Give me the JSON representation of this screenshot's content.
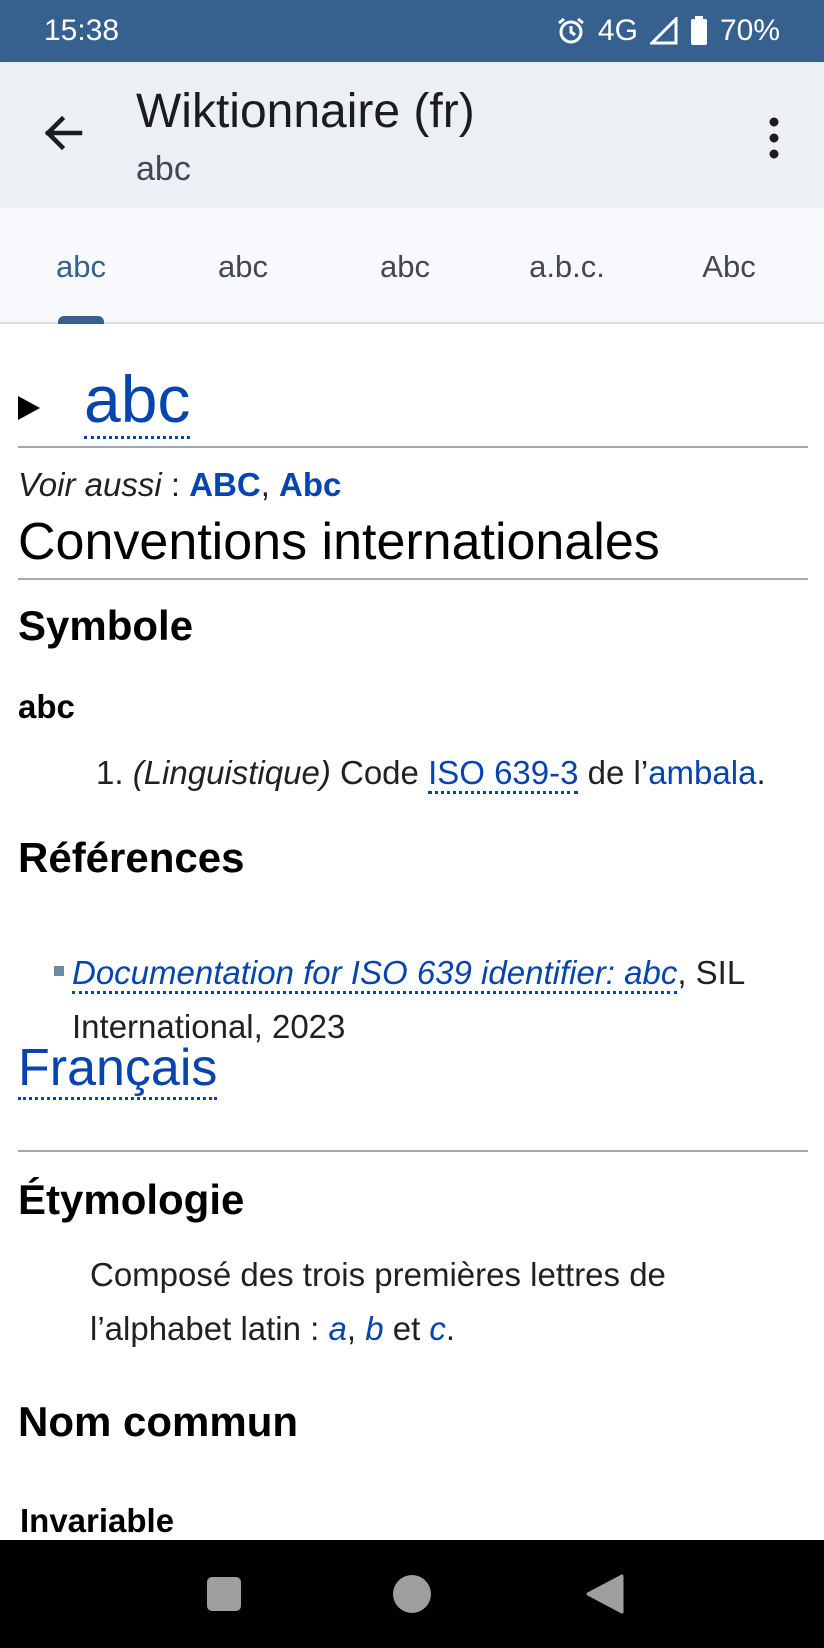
{
  "status_bar": {
    "time": "15:38",
    "network": "4G",
    "battery": "70%",
    "alarm_icon": "alarm-icon",
    "signal_icon": "signal-icon",
    "battery_icon": "battery-icon"
  },
  "app_bar": {
    "back_icon": "arrow-back-icon",
    "title": "Wiktionnaire (fr)",
    "subtitle": "abc",
    "more_icon": "more-vert-icon"
  },
  "tabs": [
    {
      "label": "abc",
      "active": true
    },
    {
      "label": "abc",
      "active": false
    },
    {
      "label": "abc",
      "active": false
    },
    {
      "label": "a.b.c.",
      "active": false
    },
    {
      "label": "Abc",
      "active": false
    }
  ],
  "article": {
    "heading": "abc",
    "voir_aussi": {
      "label": "Voir aussi",
      "sep": " : ",
      "links": [
        "ABC",
        "Abc"
      ],
      "comma": ", "
    },
    "section_conventions": "Conventions internationales",
    "symbole_heading": "Symbole",
    "symbole_word": "abc",
    "definition": {
      "number": "1.",
      "domain": "(Linguistique)",
      "text_code": " Code ",
      "link_iso": "ISO 639-3",
      "text_de": " de l’",
      "link_lang": "ambala",
      "end": "."
    },
    "references_heading": "Références",
    "reference": {
      "link": "Documentation for ISO 639 identifier: abc",
      "rest_line1": ", SIL",
      "rest_line2": "International, 2023"
    },
    "francais_heading": "Français",
    "etymologie_heading": "Étymologie",
    "etymologie": {
      "line1": "Composé des trois premières lettres de",
      "line2_start": "l’alphabet latin : ",
      "a": "a",
      "comma": ", ",
      "b": "b",
      "et": " et ",
      "c": "c",
      "end": "."
    },
    "nom_commun_heading": "Nom commun",
    "invariable": "Invariable"
  },
  "nav_bar": {
    "recents_icon": "recents-square-icon",
    "home_icon": "home-circle-icon",
    "back_icon": "back-triangle-icon"
  },
  "colors": {
    "status_bar": "#36618e",
    "app_bar": "#eceff3",
    "tab_active": "#36618e",
    "link": "#0645ad"
  }
}
